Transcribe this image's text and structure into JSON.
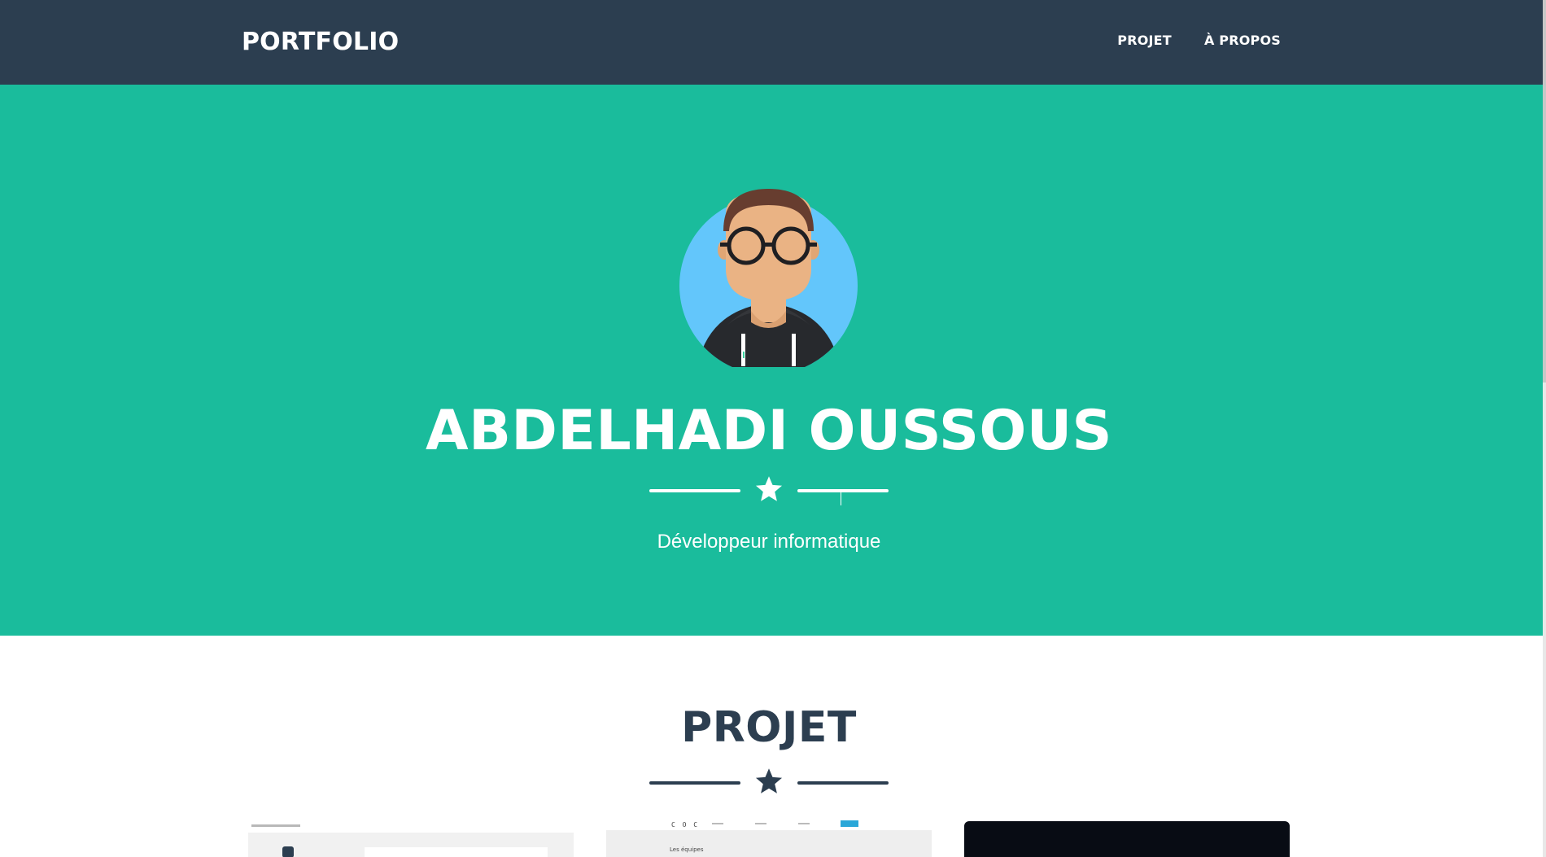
{
  "navbar": {
    "brand": "PORTFOLIO",
    "links": [
      "PROJET",
      "À PROPOS"
    ]
  },
  "hero": {
    "name": "ABDELHADI OUSSOUS",
    "subtitle": "Développeur informatique",
    "avatar_icon": "developer-avatar-icon",
    "divider_icon": "star-icon"
  },
  "projects": {
    "title": "PROJET",
    "divider_icon": "star-icon",
    "card_2_caption": "Les équipes",
    "card_2_brand": "C O C"
  },
  "colors": {
    "navbar_bg": "#2c3e50",
    "hero_bg": "#1abc9c",
    "text_dark": "#2c3e50",
    "text_light": "#ffffff"
  }
}
